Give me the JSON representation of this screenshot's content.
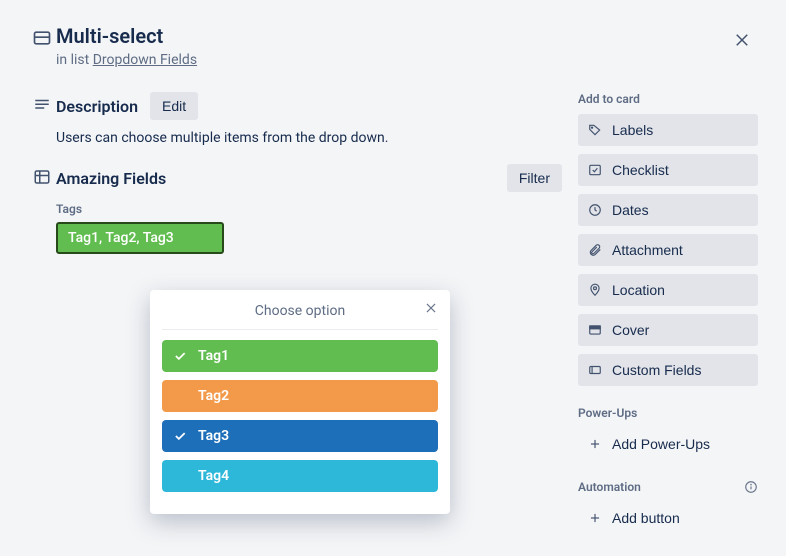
{
  "header": {
    "title": "Multi-select",
    "list_prefix": "in list ",
    "list_name": "Dropdown Fields"
  },
  "description": {
    "title": "Description",
    "edit": "Edit",
    "text": "Users can choose multiple items from the drop down."
  },
  "amazing_fields": {
    "title": "Amazing Fields",
    "filter": "Filter",
    "tags_label": "Tags",
    "tags_value": "Tag1, Tag2, Tag3"
  },
  "popover": {
    "title": "Choose option",
    "options": [
      {
        "label": "Tag1",
        "selected": true,
        "color": "#61bd4f"
      },
      {
        "label": "Tag2",
        "selected": false,
        "color": "#f2994a"
      },
      {
        "label": "Tag3",
        "selected": true,
        "color": "#1e6fb9"
      },
      {
        "label": "Tag4",
        "selected": false,
        "color": "#2db7d9"
      }
    ]
  },
  "sidebar": {
    "add_to_card": "Add to card",
    "labels": "Labels",
    "checklist": "Checklist",
    "dates": "Dates",
    "attachment": "Attachment",
    "location": "Location",
    "cover": "Cover",
    "custom_fields": "Custom Fields",
    "power_ups": "Power-Ups",
    "add_power_ups": "Add Power-Ups",
    "automation": "Automation",
    "add_button": "Add button"
  }
}
